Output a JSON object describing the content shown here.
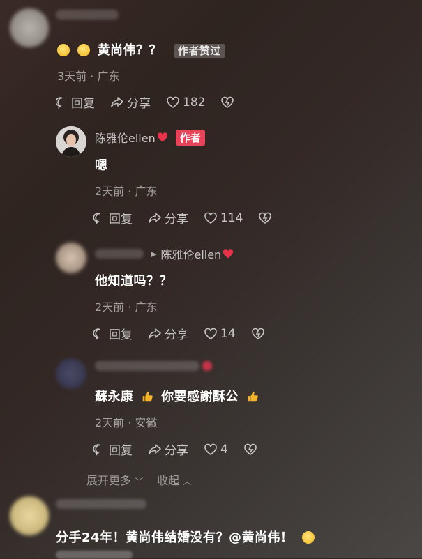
{
  "comments": [
    {
      "text": "黄尚伟？？",
      "tag": "作者赞过",
      "meta": "3天前 · 广东",
      "reply_label": "回复",
      "share_label": "分享",
      "likes": "182"
    }
  ],
  "author_reply": {
    "username": "陈雅伦ellen",
    "tag": "作者",
    "text": "嗯",
    "meta": "2天前 · 广东",
    "reply_label": "回复",
    "share_label": "分享",
    "likes": "114"
  },
  "reply_to_author": {
    "reply_target": "陈雅伦ellen",
    "text": "他知道吗？？",
    "meta": "2天前 · 广东",
    "reply_label": "回复",
    "share_label": "分享",
    "likes": "14"
  },
  "reply_third": {
    "text_part1": "蘇永康",
    "text_part2": "你要感謝酥公",
    "meta": "2天前 · 安徽",
    "reply_label": "回复",
    "share_label": "分享",
    "likes": "4"
  },
  "expand_bar": {
    "expand_label": "展开更多",
    "collapse_label": "收起"
  },
  "next_comment": {
    "text": "分手24年！黄尚伟结婚没有？@黄尚伟！"
  },
  "colors": {
    "author_tag": "#e9435a",
    "heart_red": "#e8324a"
  },
  "icons": [
    "reply-icon",
    "share-icon",
    "like-heart-icon",
    "dislike-broken-heart-icon",
    "red-heart-icon",
    "thumbs-up-emoji",
    "dizzy-face-emoji",
    "laughing-face-emoji"
  ]
}
